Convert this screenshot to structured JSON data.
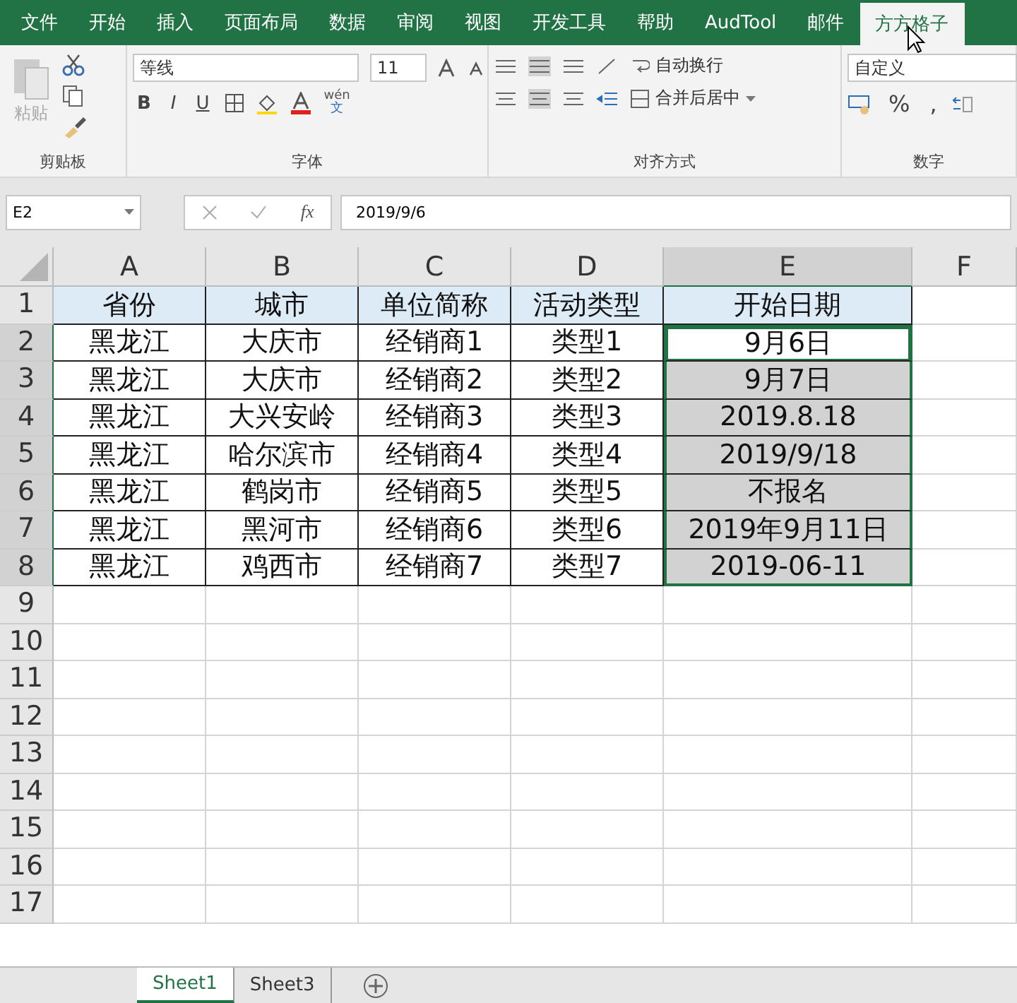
{
  "menu_tabs": [
    {
      "label": "文件",
      "selected": false
    },
    {
      "label": "开始",
      "selected": false
    },
    {
      "label": "插入",
      "selected": false
    },
    {
      "label": "页面布局",
      "selected": false
    },
    {
      "label": "数据",
      "selected": false
    },
    {
      "label": "审阅",
      "selected": false
    },
    {
      "label": "视图",
      "selected": false
    },
    {
      "label": "开发工具",
      "selected": false
    },
    {
      "label": "帮助",
      "selected": false
    },
    {
      "label": "AudTool",
      "selected": false
    },
    {
      "label": "邮件",
      "selected": false
    },
    {
      "label": "方方格子",
      "selected": true
    }
  ],
  "ribbon": {
    "clipboard": {
      "paste": "粘贴",
      "label": "剪贴板"
    },
    "font": {
      "name": "等线",
      "size": "11",
      "bold": "B",
      "italic": "I",
      "underline": "U",
      "phonetic": [
        "wén",
        "文"
      ],
      "label": "字体"
    },
    "alignment": {
      "wrap_text": "自动换行",
      "merge_center": "合并后居中",
      "label": "对齐方式"
    },
    "number": {
      "format": "自定义",
      "percent": "%",
      "comma": ",",
      "label": "数字"
    }
  },
  "formula_bar": {
    "name_box": "E2",
    "fx": "fx",
    "formula": "2019/9/6"
  },
  "columns": [
    {
      "label": "A",
      "selected": false
    },
    {
      "label": "B",
      "selected": false
    },
    {
      "label": "C",
      "selected": false
    },
    {
      "label": "D",
      "selected": false
    },
    {
      "label": "E",
      "selected": true
    },
    {
      "label": "F",
      "selected": false
    }
  ],
  "rows": [
    {
      "number": "1",
      "cells": [
        "省份",
        "城市",
        "单位简称",
        "活动类型",
        "开始日期"
      ],
      "header": true,
      "selected": false,
      "active": false
    },
    {
      "number": "2",
      "cells": [
        "黑龙江",
        "大庆市",
        "经销商1",
        "类型1",
        "9月6日"
      ],
      "header": false,
      "selected": true,
      "active": true
    },
    {
      "number": "3",
      "cells": [
        "黑龙江",
        "大庆市",
        "经销商2",
        "类型2",
        "9月7日"
      ],
      "header": false,
      "selected": true,
      "active": false
    },
    {
      "number": "4",
      "cells": [
        "黑龙江",
        "大兴安岭",
        "经销商3",
        "类型3",
        "2019.8.18"
      ],
      "header": false,
      "selected": true,
      "active": false
    },
    {
      "number": "5",
      "cells": [
        "黑龙江",
        "哈尔滨市",
        "经销商4",
        "类型4",
        "2019/9/18"
      ],
      "header": false,
      "selected": true,
      "active": false
    },
    {
      "number": "6",
      "cells": [
        "黑龙江",
        "鹤岗市",
        "经销商5",
        "类型5",
        "不报名"
      ],
      "header": false,
      "selected": true,
      "active": false
    },
    {
      "number": "7",
      "cells": [
        "黑龙江",
        "黑河市",
        "经销商6",
        "类型6",
        "2019年9月11日"
      ],
      "header": false,
      "selected": true,
      "active": false
    },
    {
      "number": "8",
      "cells": [
        "黑龙江",
        "鸡西市",
        "经销商7",
        "类型7",
        "2019-06-11"
      ],
      "header": false,
      "selected": true,
      "active": false
    },
    {
      "number": "9",
      "cells": [],
      "header": false,
      "selected": false,
      "active": false
    },
    {
      "number": "10",
      "cells": [],
      "header": false,
      "selected": false,
      "active": false
    },
    {
      "number": "11",
      "cells": [],
      "header": false,
      "selected": false,
      "active": false
    },
    {
      "number": "12",
      "cells": [],
      "header": false,
      "selected": false,
      "active": false
    },
    {
      "number": "13",
      "cells": [],
      "header": false,
      "selected": false,
      "active": false
    },
    {
      "number": "14",
      "cells": [],
      "header": false,
      "selected": false,
      "active": false
    },
    {
      "number": "15",
      "cells": [],
      "header": false,
      "selected": false,
      "active": false
    },
    {
      "number": "16",
      "cells": [],
      "header": false,
      "selected": false,
      "active": false
    },
    {
      "number": "17",
      "cells": [],
      "header": false,
      "selected": false,
      "active": false
    }
  ],
  "sheet_tabs": [
    {
      "label": "Sheet1",
      "selected": true
    },
    {
      "label": "Sheet3",
      "selected": false
    }
  ]
}
